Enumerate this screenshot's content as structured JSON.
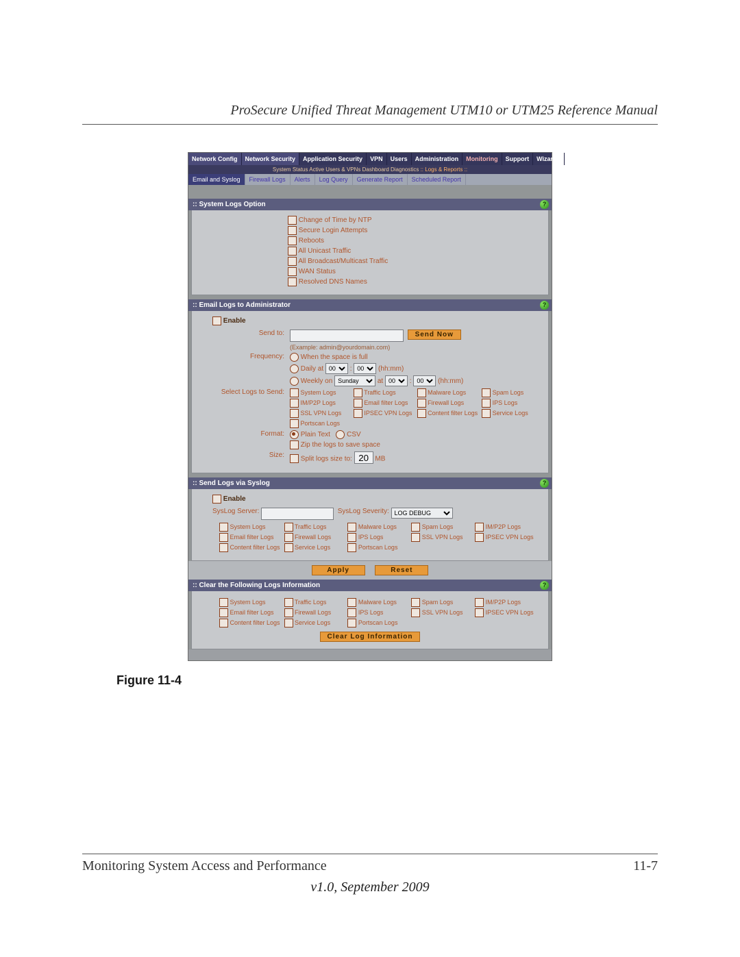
{
  "doc": {
    "header": "ProSecure Unified Threat Management UTM10 or UTM25 Reference Manual",
    "figure_caption": "Figure 11-4",
    "footer_left": "Monitoring System Access and Performance",
    "footer_right": "11-7",
    "version": "v1.0, September 2009"
  },
  "top_tabs": [
    "Network Config",
    "Network Security",
    "Application Security",
    "VPN",
    "Users",
    "Administration",
    "Monitoring",
    "Support",
    "Wizards"
  ],
  "sub_bar": {
    "items": "System Status   Active Users & VPNs   Dashboard   Diagnostics",
    "highlight": ":: Logs & Reports ::"
  },
  "sub_tabs": [
    "Email and Syslog",
    "Firewall Logs",
    "Alerts",
    "Log Query",
    "Generate Report",
    "Scheduled Report"
  ],
  "sections": {
    "sys_logs": {
      "title": ":: System Logs Option",
      "opts": [
        "Change of Time by NTP",
        "Secure Login Attempts",
        "Reboots",
        "All Unicast Traffic",
        "All Broadcast/Multicast Traffic",
        "WAN Status",
        "Resolved DNS Names"
      ]
    },
    "email_admin": {
      "title": ":: Email Logs to Administrator",
      "enable": "Enable",
      "send_to_lbl": "Send to:",
      "send_now": "Send Now",
      "example": "(Example: admin@yourdomain.com)",
      "freq_lbl": "Frequency:",
      "freq_opts": {
        "full": "When the space is full",
        "daily_prefix": "Daily at",
        "daily_suffix": "(hh:mm)",
        "weekly_prefix": "Weekly on",
        "weekly_mid": "at",
        "weekly_suffix": "(hh:mm)",
        "hh1": "00",
        "mm1": "00",
        "day": "Sunday",
        "hh2": "00",
        "mm2": "00"
      },
      "select_lbl": "Select Logs to Send:",
      "logs": [
        "System Logs",
        "Traffic Logs",
        "Malware Logs",
        "Spam Logs",
        "IM/P2P Logs",
        "Email filter Logs",
        "Firewall Logs",
        "IPS Logs",
        "SSL VPN Logs",
        "IPSEC VPN Logs",
        "Content filter Logs",
        "Service Logs",
        "Portscan Logs"
      ],
      "format_lbl": "Format:",
      "format_plain": "Plain Text",
      "format_csv": "CSV",
      "zip": "Zip the logs to save space",
      "size_lbl": "Size:",
      "split": "Split logs size to:",
      "split_val": "20",
      "split_unit": "MB"
    },
    "syslog": {
      "title": ":: Send Logs via Syslog",
      "enable": "Enable",
      "server_lbl": "SysLog Server:",
      "sev_lbl": "SysLog Severity:",
      "sev_val": "LOG DEBUG",
      "logs": [
        "System Logs",
        "Traffic Logs",
        "Malware Logs",
        "Spam Logs",
        "IM/P2P Logs",
        "Email filter Logs",
        "Firewall Logs",
        "IPS Logs",
        "SSL VPN Logs",
        "IPSEC VPN Logs",
        "Content filter Logs",
        "Service Logs",
        "Portscan Logs"
      ],
      "apply": "Apply",
      "reset": "Reset"
    },
    "clear": {
      "title": ":: Clear the Following Logs Information",
      "logs": [
        "System Logs",
        "Traffic Logs",
        "Malware Logs",
        "Spam Logs",
        "IM/P2P Logs",
        "Email filter Logs",
        "Firewall Logs",
        "IPS Logs",
        "SSL VPN Logs",
        "IPSEC VPN Logs",
        "Content filter Logs",
        "Service Logs",
        "Portscan Logs"
      ],
      "btn": "Clear Log Information"
    }
  }
}
